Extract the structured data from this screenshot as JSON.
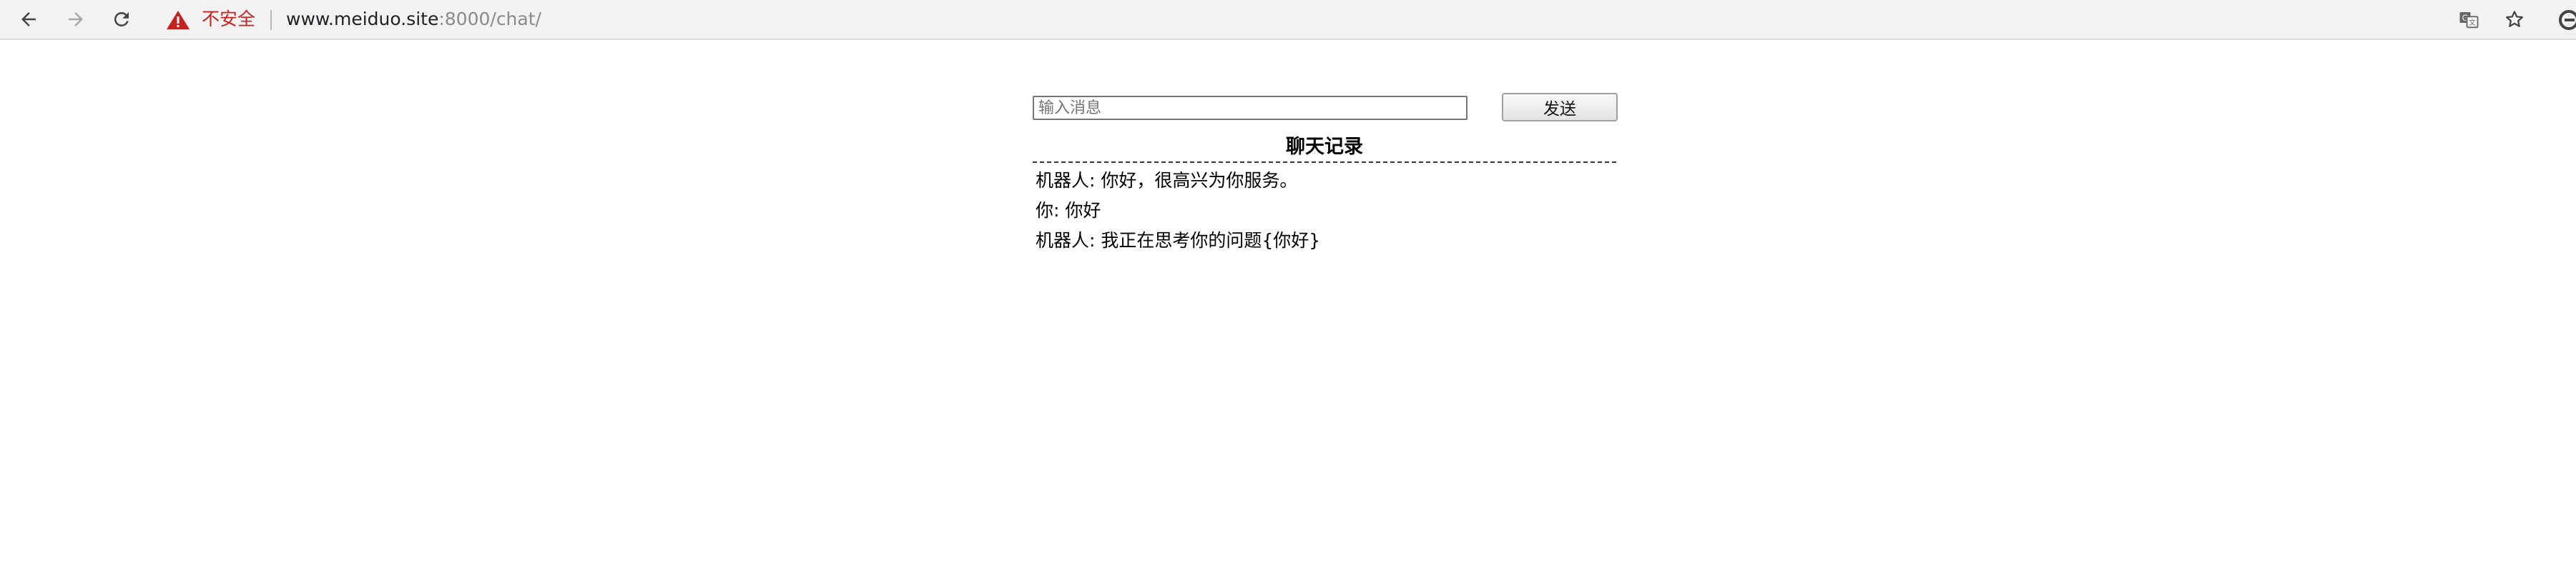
{
  "browser": {
    "security_label": "不安全",
    "url_host": "www.meiduo.site",
    "url_rest": ":8000/chat/",
    "icons": {
      "back": "arrow-left-icon",
      "forward": "arrow-right-icon",
      "reload": "reload-icon",
      "warning": "warning-triangle-icon",
      "translate": "translate-icon",
      "bookmark": "star-icon",
      "extension": "extension-icon"
    },
    "colors": {
      "warning": "#c5221f",
      "toolbar_bg": "#f2f2f2"
    }
  },
  "chat": {
    "input_placeholder": "输入消息",
    "input_value": "",
    "send_label": "发送",
    "history_title": "聊天记录",
    "messages": [
      {
        "text": "机器人: 你好，很高兴为你服务。"
      },
      {
        "text": "你: 你好"
      },
      {
        "text": "机器人: 我正在思考你的问题{你好}"
      }
    ]
  }
}
